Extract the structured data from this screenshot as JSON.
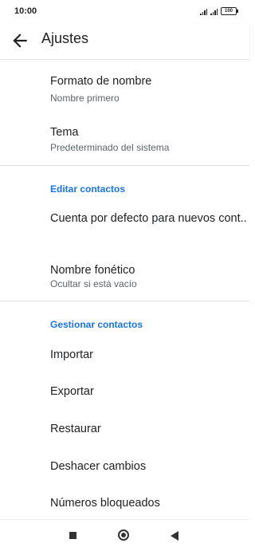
{
  "status_bar": {
    "time": "10:00",
    "battery": "100",
    "signal_icon": "signal-icon"
  },
  "app_bar": {
    "title": "Ajustes",
    "back_icon": "arrow-back-icon"
  },
  "items": [
    {
      "primary": "Formato de nombre",
      "secondary": "Nombre primero"
    },
    {
      "primary": "Tema",
      "secondary": "Predeterminado del sistema"
    }
  ],
  "sections": {
    "editar": {
      "header": "Editar contactos"
    },
    "gestionar": {
      "header": "Gestionar contactos"
    }
  },
  "editar_items": [
    {
      "primary": "Cuenta por defecto para nuevos cont.."
    },
    {
      "primary": "Nombre fonético",
      "secondary": "Ocultar si está vacío"
    }
  ],
  "gestionar_items": [
    {
      "primary": "Importar"
    },
    {
      "primary": "Exportar"
    },
    {
      "primary": "Restaurar"
    },
    {
      "primary": "Deshacer cambios"
    },
    {
      "primary": "Números bloqueados"
    }
  ],
  "nav_bar": {
    "recents_icon": "square-icon",
    "home_icon": "circle-icon",
    "back_icon": "triangle-back-icon"
  }
}
